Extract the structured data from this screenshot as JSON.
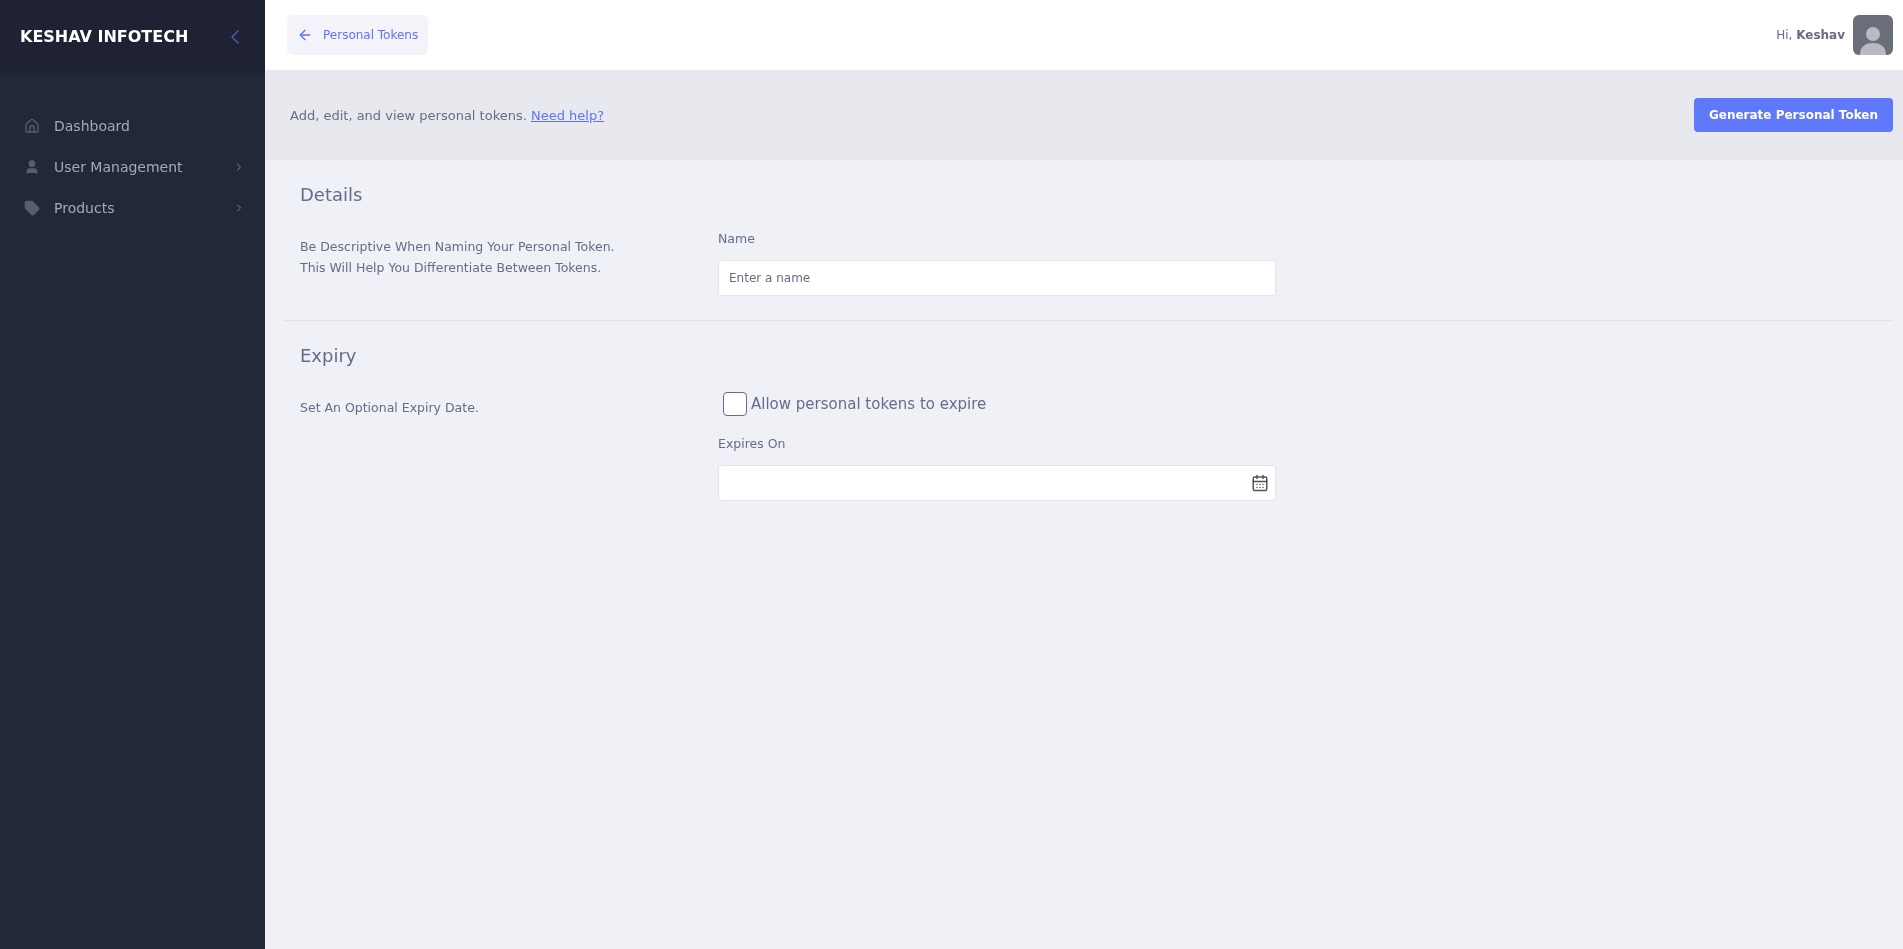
{
  "sidebar": {
    "brand": "KESHAV INFOTECH",
    "items": [
      {
        "label": "Dashboard",
        "kind": "home",
        "has_submenu": false,
        "selected": false
      },
      {
        "label": "User Management",
        "kind": "user",
        "has_submenu": true,
        "selected": false
      },
      {
        "label": "Products",
        "kind": "tag",
        "has_submenu": true,
        "selected": false
      }
    ]
  },
  "header": {
    "back_label": "Personal Tokens",
    "greeting": "Hi,",
    "user": "Keshav"
  },
  "banner": {
    "text": "Add, edit, and view personal tokens.",
    "link": "Need help?",
    "button": "Generate Personal Token"
  },
  "sections": [
    {
      "kind": "name",
      "title": "Details",
      "description": [
        "Be Descriptive When Naming Your Personal Token.",
        "This Will Help You Differentiate Between Tokens."
      ],
      "field_label": "Name",
      "placeholder": "Enter a name"
    },
    {
      "kind": "expiry",
      "title": "Expiry",
      "description": [
        "Set An Optional Expiry Date."
      ],
      "checkbox_label": "Allow personal tokens to expire",
      "checked": false,
      "field_label": "Expires On"
    }
  ]
}
